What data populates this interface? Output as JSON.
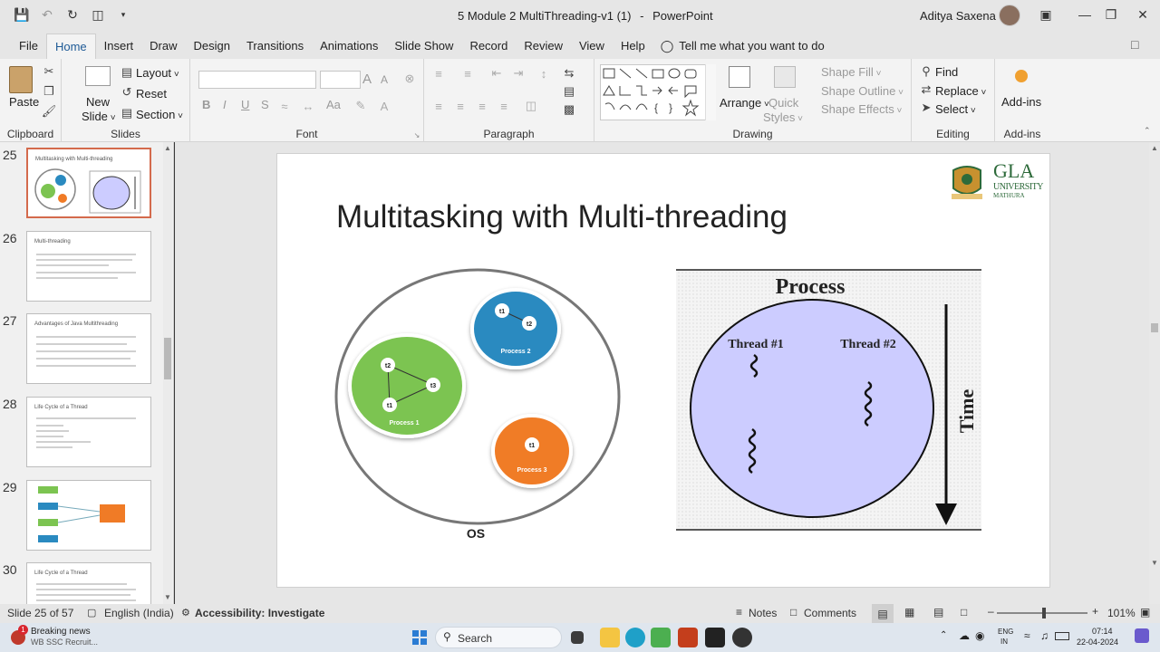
{
  "app": {
    "document_title": "5 Module 2 MultiThreading-v1 (1)",
    "separator": "-",
    "app_name": "PowerPoint",
    "user_name": "Aditya Saxena"
  },
  "tabs": [
    "File",
    "Home",
    "Insert",
    "Draw",
    "Design",
    "Transitions",
    "Animations",
    "Slide Show",
    "Record",
    "Review",
    "View",
    "Help"
  ],
  "active_tab": "Home",
  "tell_me": "Tell me what you want to do",
  "ribbon": {
    "clipboard": {
      "paste": "Paste",
      "label": "Clipboard"
    },
    "slides": {
      "new_slide_1": "New",
      "new_slide_2": "Slide",
      "layout": "Layout",
      "reset": "Reset",
      "section": "Section",
      "label": "Slides"
    },
    "font": {
      "bold": "B",
      "italic": "I",
      "underline": "U",
      "strike": "S",
      "label": "Font",
      "aa1": "A",
      "aa2": "A",
      "aa3": "Aa"
    },
    "paragraph": {
      "label": "Paragraph"
    },
    "drawing": {
      "arrange": "Arrange",
      "quick": "Quick",
      "styles": "Styles",
      "shape_fill": "Shape Fill",
      "shape_outline": "Shape Outline",
      "shape_effects": "Shape Effects",
      "label": "Drawing"
    },
    "editing": {
      "find": "Find",
      "replace": "Replace",
      "select": "Select",
      "label": "Editing"
    },
    "addins": {
      "button": "Add-ins",
      "label": "Add-ins"
    }
  },
  "thumbnails": [
    {
      "num": "25",
      "title": "Multitasking with Multi-threading",
      "selected": true
    },
    {
      "num": "26",
      "title": "Multi-threading",
      "selected": false
    },
    {
      "num": "27",
      "title": "Advantages of Java Multithreading",
      "selected": false
    },
    {
      "num": "28",
      "title": "Life Cycle of a Thread",
      "selected": false
    },
    {
      "num": "29",
      "title": "",
      "selected": false
    },
    {
      "num": "30",
      "title": "Life Cycle of a Thread",
      "selected": false
    }
  ],
  "slide": {
    "title": "Multitasking with Multi-threading",
    "logo": {
      "name": "GLA",
      "sub": "UNIVERSITY",
      "city": "MATHURA"
    },
    "os_diagram": {
      "os_label": "OS",
      "process1": {
        "label": "Process 1",
        "threads": [
          "t2",
          "t3",
          "t1"
        ],
        "color": "#7cc451"
      },
      "process2": {
        "label": "Process 2",
        "threads": [
          "t1",
          "t2"
        ],
        "color": "#2a8ac0"
      },
      "process3": {
        "label": "Process 3",
        "threads": [
          "t1"
        ],
        "color": "#f07b26"
      }
    },
    "process_diagram": {
      "title": "Process",
      "thread1": "Thread #1",
      "thread2": "Thread #2",
      "time": "Time",
      "fill": "#ccccff"
    }
  },
  "status": {
    "slide_info": "Slide 25 of 57",
    "language": "English (India)",
    "accessibility": "Accessibility: Investigate",
    "notes": "Notes",
    "comments": "Comments",
    "zoom": "101%"
  },
  "taskbar": {
    "news_title": "Breaking news",
    "news_sub": "WB SSC Recruit...",
    "badge": "1",
    "search": "Search",
    "lang1": "ENG",
    "lang2": "IN",
    "time": "07:14",
    "date": "22-04-2024"
  }
}
